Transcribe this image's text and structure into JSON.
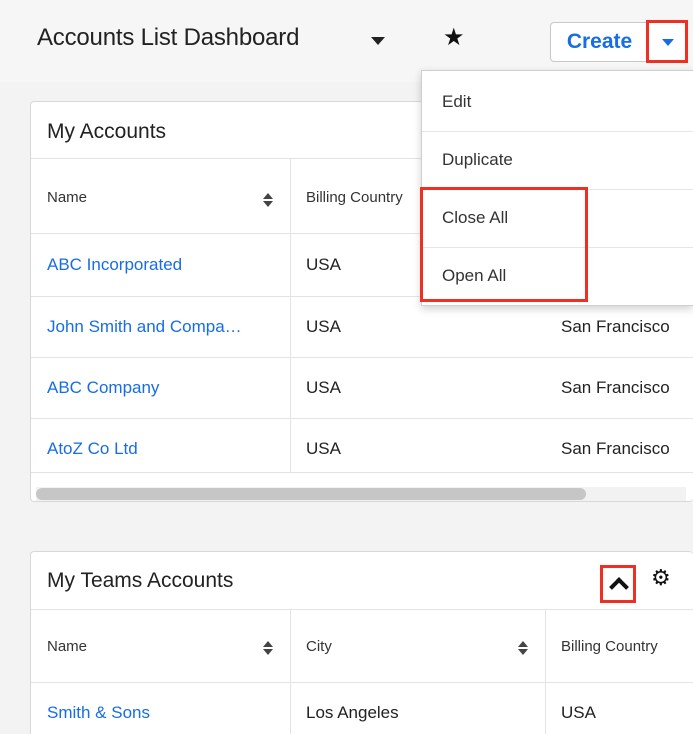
{
  "header": {
    "title": "Accounts List Dashboard",
    "create_label": "Create"
  },
  "menu": {
    "items": [
      "Edit",
      "Duplicate",
      "Close All",
      "Open All"
    ]
  },
  "my_accounts": {
    "title": "My Accounts",
    "columns": [
      "Name",
      "Billing Country"
    ],
    "rows": [
      {
        "name": "ABC Incorporated",
        "country": "USA",
        "city": ""
      },
      {
        "name": "John Smith and Compa…",
        "country": "USA",
        "city": "San Francisco"
      },
      {
        "name": "ABC Company",
        "country": "USA",
        "city": "San Francisco"
      },
      {
        "name": "AtoZ Co Ltd",
        "country": "USA",
        "city": "San Francisco"
      }
    ]
  },
  "team_accounts": {
    "title": "My Teams Accounts",
    "columns": [
      "Name",
      "City",
      "Billing Country"
    ],
    "rows": [
      {
        "name": "Smith & Sons",
        "city": "Los Angeles",
        "country": "USA"
      }
    ]
  },
  "colors": {
    "link": "#176de5",
    "highlight": "#ef2f22"
  }
}
